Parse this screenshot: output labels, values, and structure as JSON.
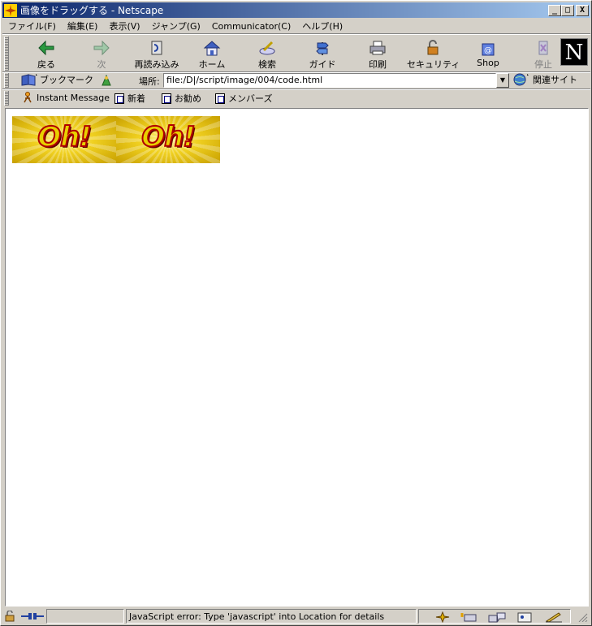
{
  "window": {
    "title": "画像をドラッグする - Netscape",
    "minimize": "_",
    "maximize": "□",
    "close": "X"
  },
  "menu": [
    "ファイル(F)",
    "編集(E)",
    "表示(V)",
    "ジャンプ(G)",
    "Communicator(C)",
    "ヘルプ(H)"
  ],
  "nav": {
    "back": "戻る",
    "forward": "次",
    "reload": "再読み込み",
    "home": "ホーム",
    "search": "検索",
    "guide": "ガイド",
    "print": "印刷",
    "security": "セキュリティ",
    "shop": "Shop",
    "stop": "停止",
    "logo": "N"
  },
  "location": {
    "bookmarks": "ブックマーク",
    "label": "場所:",
    "url": "file:/D|/script/image/004/code.html",
    "related": "関連サイト"
  },
  "personal": {
    "instant_message": "Instant Message",
    "new": "新着",
    "recommend": "お勧め",
    "members": "メンバーズ"
  },
  "content": {
    "image_text_1": "Oh!",
    "image_text_2": "Oh!"
  },
  "status": {
    "message": "JavaScript error: Type 'javascript' into Location for details"
  },
  "colors": {
    "titlebar_start": "#0a246a",
    "titlebar_end": "#a6caf0",
    "chrome": "#d4d0c8",
    "oh_text": "#e8d000",
    "oh_outline": "#b00000"
  }
}
